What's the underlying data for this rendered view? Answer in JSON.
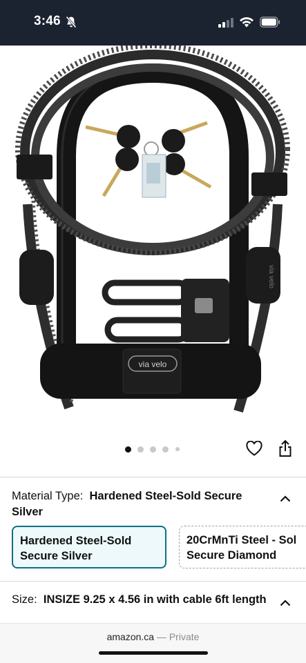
{
  "status_bar": {
    "time": "3:46"
  },
  "carousel": {
    "dots": 5,
    "active_index": 0
  },
  "material": {
    "label": "Material Type:",
    "value": "Hardened Steel-Sold Secure Silver",
    "options": [
      {
        "line1": "Hardened Steel-Sold",
        "line2": "Secure Silver",
        "selected": true
      },
      {
        "line1": "20CrMnTi Steel - Sol",
        "line2": "Secure Diamond",
        "selected": false
      }
    ]
  },
  "size": {
    "label": "Size:",
    "value": "INSIZE 9.25 x 4.56 in with cable 6ft length"
  },
  "browser": {
    "domain": "amazon.ca",
    "separator": " — ",
    "mode": "Private"
  },
  "product_image": {
    "brand_text": "via velo",
    "side_text": "via velo"
  },
  "colors": {
    "accent": "#0f6f85",
    "status_bg": "#1b2230"
  }
}
